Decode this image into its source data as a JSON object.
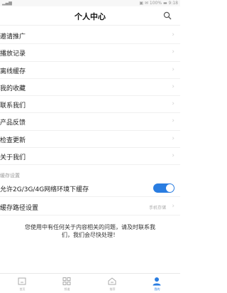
{
  "status": {
    "right_text": "▣ ✉ 100% ▬ 9:18"
  },
  "header": {
    "title": "个人中心"
  },
  "menu": [
    {
      "label": "邀请推广"
    },
    {
      "label": "播放记录"
    },
    {
      "label": "离线缓存"
    },
    {
      "label": "我的收藏"
    },
    {
      "label": "联系我们"
    },
    {
      "label": "产品反馈"
    },
    {
      "label": "检查更新"
    },
    {
      "label": "关于我们"
    }
  ],
  "cache_section": {
    "header": "缓存设置",
    "allow_label": "允许2G/3G/4G网络环境下缓存",
    "allow_on": true,
    "path_label": "缓存路径设置",
    "path_value": "手机存储"
  },
  "notice": {
    "line1": "您使用中有任何关于内容相关的问题，请及时联系我",
    "line2": "们，我们会尽快处理！"
  },
  "tabbar": [
    {
      "label": "首页",
      "icon": "home-icon"
    },
    {
      "label": "频道",
      "icon": "grid-icon"
    },
    {
      "label": "推荐",
      "icon": "cloud-icon"
    },
    {
      "label": "我的",
      "icon": "user-icon",
      "active": true
    }
  ],
  "colors": {
    "accent": "#2a7de1",
    "chevron": "#cfcfcf",
    "muted": "#999999"
  }
}
